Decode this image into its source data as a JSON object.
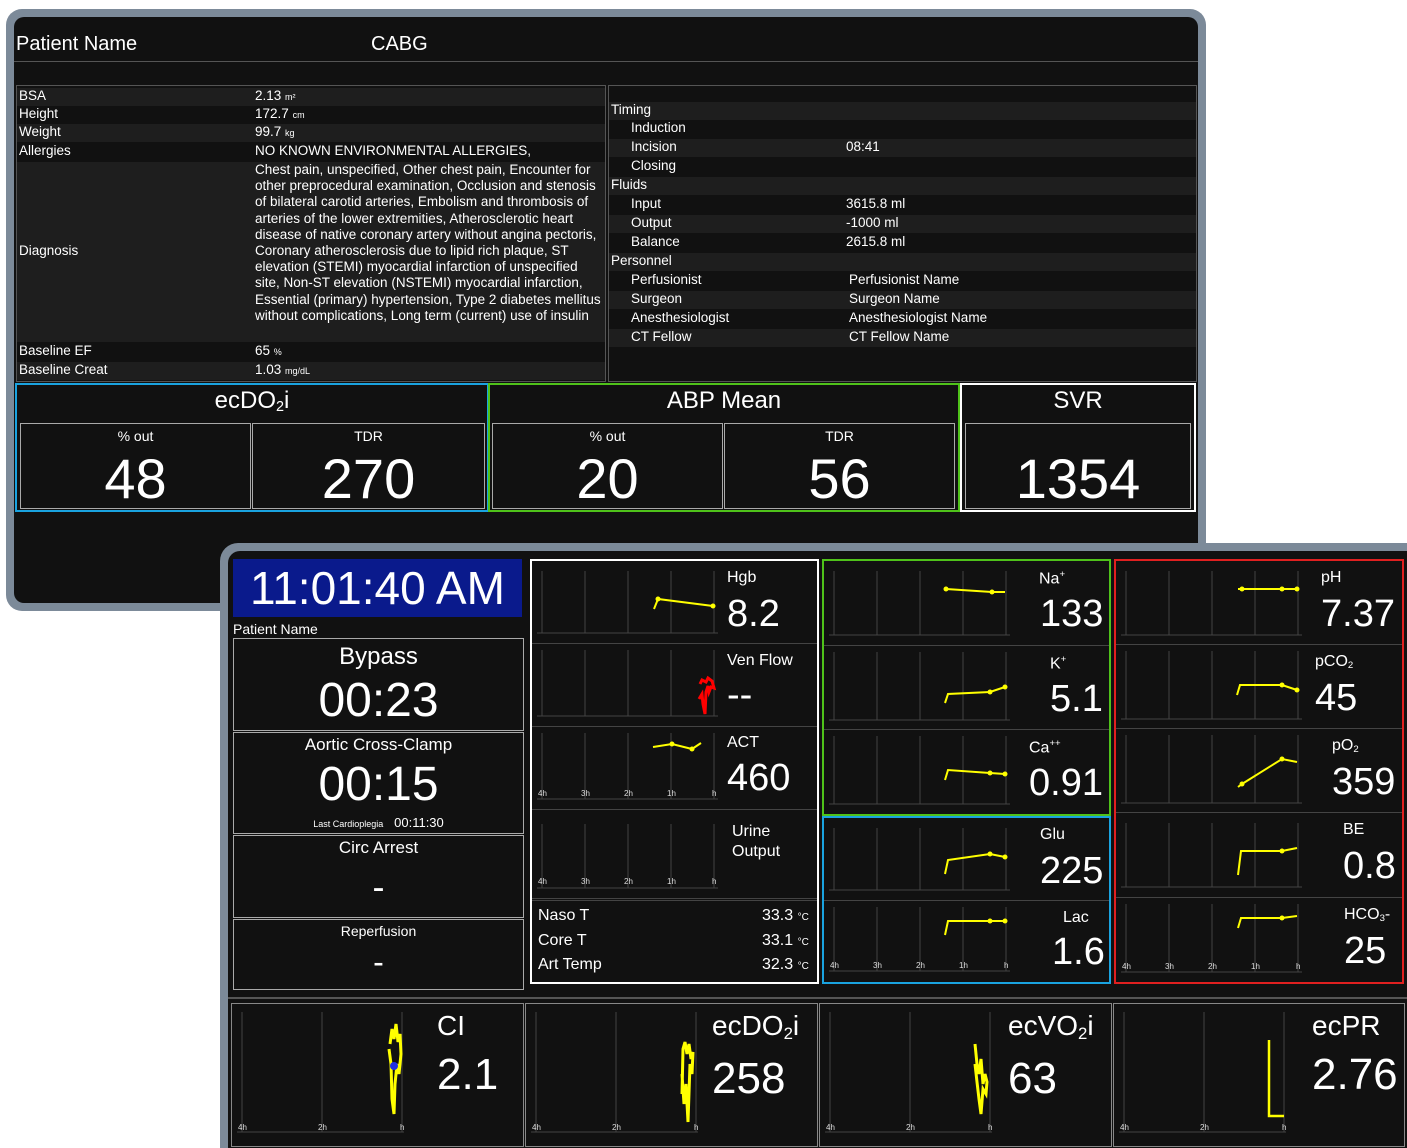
{
  "top": {
    "patient_name": "Patient Name",
    "procedure": "CABG",
    "info": {
      "bsa_label": "BSA",
      "bsa": "2.13",
      "bsa_unit": "m²",
      "height_label": "Height",
      "height": "172.7",
      "height_unit": "cm",
      "weight_label": "Weight",
      "weight": "99.7",
      "weight_unit": "kg",
      "allergies_label": "Allergies",
      "allergies": "NO KNOWN ENVIRONMENTAL ALLERGIES,",
      "diagnosis_label": "Diagnosis",
      "diagnosis": "Chest pain, unspecified, Other chest pain, Encounter for other preprocedural examination, Occlusion and stenosis of bilateral carotid arteries, Embolism and thrombosis of arteries of the lower extremities, Atherosclerotic heart disease of native coronary artery without angina pectoris, Coronary atherosclerosis due to lipid rich plaque, ST elevation (STEMI) myocardial infarction of unspecified site, Non-ST elevation (NSTEMI) myocardial infarction, Essential (primary) hypertension, Type 2 diabetes mellitus without complications, Long term (current) use of insulin",
      "ef_label": "Baseline EF",
      "ef": "65",
      "ef_unit": "%",
      "creat_label": "Baseline Creat",
      "creat": "1.03",
      "creat_unit": "mg/dL"
    },
    "timing": {
      "timing_label": "Timing",
      "induction_label": "Induction",
      "induction": "",
      "incision_label": "Incision",
      "incision": "08:41",
      "closing_label": "Closing",
      "closing": "",
      "fluids_label": "Fluids",
      "input_label": "Input",
      "input": "3615.8 ml",
      "output_label": "Output",
      "output": "-1000 ml",
      "balance_label": "Balance",
      "balance": "2615.8 ml",
      "personnel_label": "Personnel",
      "perfusionist_label": "Perfusionist",
      "perfusionist": "Perfusionist Name",
      "surgeon_label": "Surgeon",
      "surgeon": "Surgeon Name",
      "anesth_label": "Anesthesiologist",
      "anesth": "Anesthesiologist Name",
      "fellow_label": "CT Fellow",
      "fellow": "CT Fellow Name"
    },
    "metrics": {
      "ecdo2i_title": "ecDO",
      "ecdo2i_pct_label": "% out",
      "ecdo2i_pct": "48",
      "ecdo2i_tdr_label": "TDR",
      "ecdo2i_tdr": "270",
      "abp_title": "ABP Mean",
      "abp_pct_label": "% out",
      "abp_pct": "20",
      "abp_tdr_label": "TDR",
      "abp_tdr": "56",
      "svr_title": "SVR",
      "svr": "1354"
    },
    "colors": {
      "ecdo2i": "#1aa3e0",
      "abp": "#4fc21a",
      "svr": "#ffffff"
    }
  },
  "bottom": {
    "clock": "11:01:40 AM",
    "patient_name": "Patient Name",
    "bypass_label": "Bypass",
    "bypass": "00:23",
    "clamp_label": "Aortic Cross-Clamp",
    "clamp": "00:15",
    "cardioplegia_label": "Last Cardioplegia",
    "cardioplegia": "00:11:30",
    "circ_label": "Circ Arrest",
    "circ": "-",
    "reperf_label": "Reperfusion",
    "reperf": "-",
    "hgb_label": "Hgb",
    "hgb": "8.2",
    "venflow_label": "Ven Flow",
    "venflow": "--",
    "act_label": "ACT",
    "act": "460",
    "urine_label1": "Urine",
    "urine_label2": "Output",
    "naso_label": "Naso T",
    "naso": "33.3",
    "core_label": "Core T",
    "core": "33.1",
    "art_label": "Art Temp",
    "art": "32.3",
    "temp_unit": "°C",
    "na_label": "Na",
    "na": "133",
    "k_label": "K",
    "k": "5.1",
    "ca_label": "Ca",
    "ca": "0.91",
    "glu_label": "Glu",
    "glu": "225",
    "lac_label": "Lac",
    "lac": "1.6",
    "ph_label": "pH",
    "ph": "7.37",
    "pco2_label": "pCO",
    "pco2": "45",
    "po2_label": "pO",
    "po2": "359",
    "be_label": "BE",
    "be": "0.8",
    "hco3_label": "HCO",
    "hco3": "25",
    "ci_label": "CI",
    "ci": "2.1",
    "ecdo2i_label": "ecDO",
    "ecdo2i": "258",
    "ecvo2i_label": "ecVO",
    "ecvo2i": "63",
    "ecpr_label": "ecPR",
    "ecpr": "2.76",
    "ticks5": [
      "4h",
      "3h",
      "2h",
      "1h",
      "h"
    ],
    "ticks3": [
      "4h",
      "2h",
      "h"
    ],
    "colors": {
      "trend": "#ffff00",
      "panel_green": "#4fc21a",
      "panel_blue": "#1aa3e0",
      "panel_red": "#e02020",
      "clock_bg": "#0a1a8c",
      "venflow": "#ff0000"
    }
  }
}
